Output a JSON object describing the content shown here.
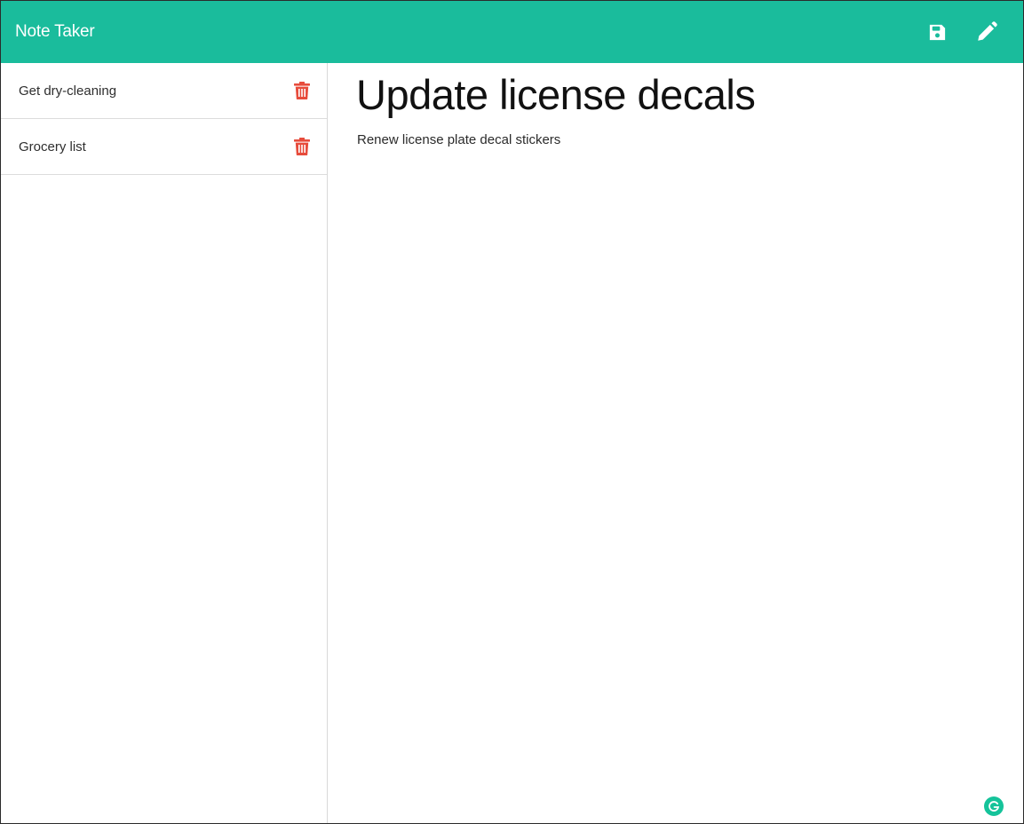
{
  "app": {
    "title": "Note Taker"
  },
  "toolbar": {
    "save_icon": "floppy-disk-icon",
    "new_note_icon": "pencil-icon"
  },
  "colors": {
    "navbar": "#1abc9c",
    "delete": "#e74c3c",
    "grammarly": "#15c39a"
  },
  "sidebar": {
    "notes": [
      {
        "title": "Get dry-cleaning",
        "icon": "trash-icon"
      },
      {
        "title": "Grocery list",
        "icon": "trash-icon"
      }
    ]
  },
  "editor": {
    "title": "Update license decals",
    "body": "Renew license plate decal stickers"
  }
}
